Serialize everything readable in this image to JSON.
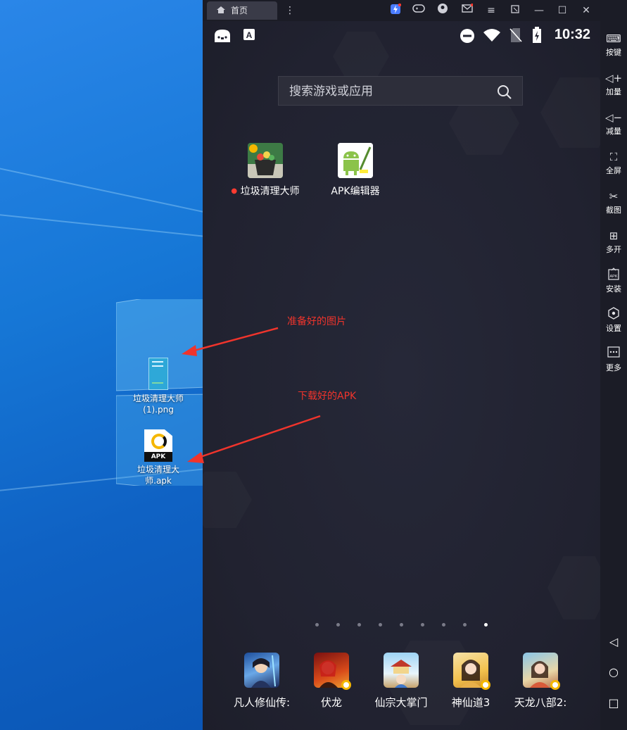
{
  "desktop": {
    "icons": [
      {
        "label": "垃圾清理大师(1).png"
      },
      {
        "label": "垃圾清理大师.apk",
        "badge_text": "APK"
      }
    ]
  },
  "annotations": {
    "picture_note": "准备好的图片",
    "apk_note": "下载好的APK",
    "color": "#f0342c"
  },
  "emulator": {
    "tab_label": "首页",
    "clock": "10:32",
    "search_placeholder": "搜索游戏或应用",
    "apps": [
      {
        "label": "垃圾清理大师",
        "has_new_dot": true
      },
      {
        "label": "APK编辑器",
        "has_new_dot": false
      }
    ],
    "page_dots": {
      "count": 9,
      "active": 9
    },
    "dock": [
      {
        "label": "凡人修仙传:"
      },
      {
        "label": "伏龙"
      },
      {
        "label": "仙宗大掌门"
      },
      {
        "label": "神仙道3"
      },
      {
        "label": "天龙八部2:"
      }
    ]
  },
  "side_panel": {
    "buttons": [
      {
        "label": "按键",
        "icon": "keyboard-icon"
      },
      {
        "label": "加量",
        "icon": "volume-up-icon"
      },
      {
        "label": "减量",
        "icon": "volume-down-icon"
      },
      {
        "label": "全屏",
        "icon": "fullscreen-icon"
      },
      {
        "label": "截图",
        "icon": "scissors-icon"
      },
      {
        "label": "多开",
        "icon": "multi-instance-icon"
      },
      {
        "label": "安装",
        "icon": "apk-install-icon"
      },
      {
        "label": "设置",
        "icon": "settings-icon"
      },
      {
        "label": "更多",
        "icon": "more-icon"
      }
    ]
  },
  "colors": {
    "accent": "#f5b700",
    "desktop_blue": "#1677d6",
    "emulator_bg": "#232432"
  }
}
